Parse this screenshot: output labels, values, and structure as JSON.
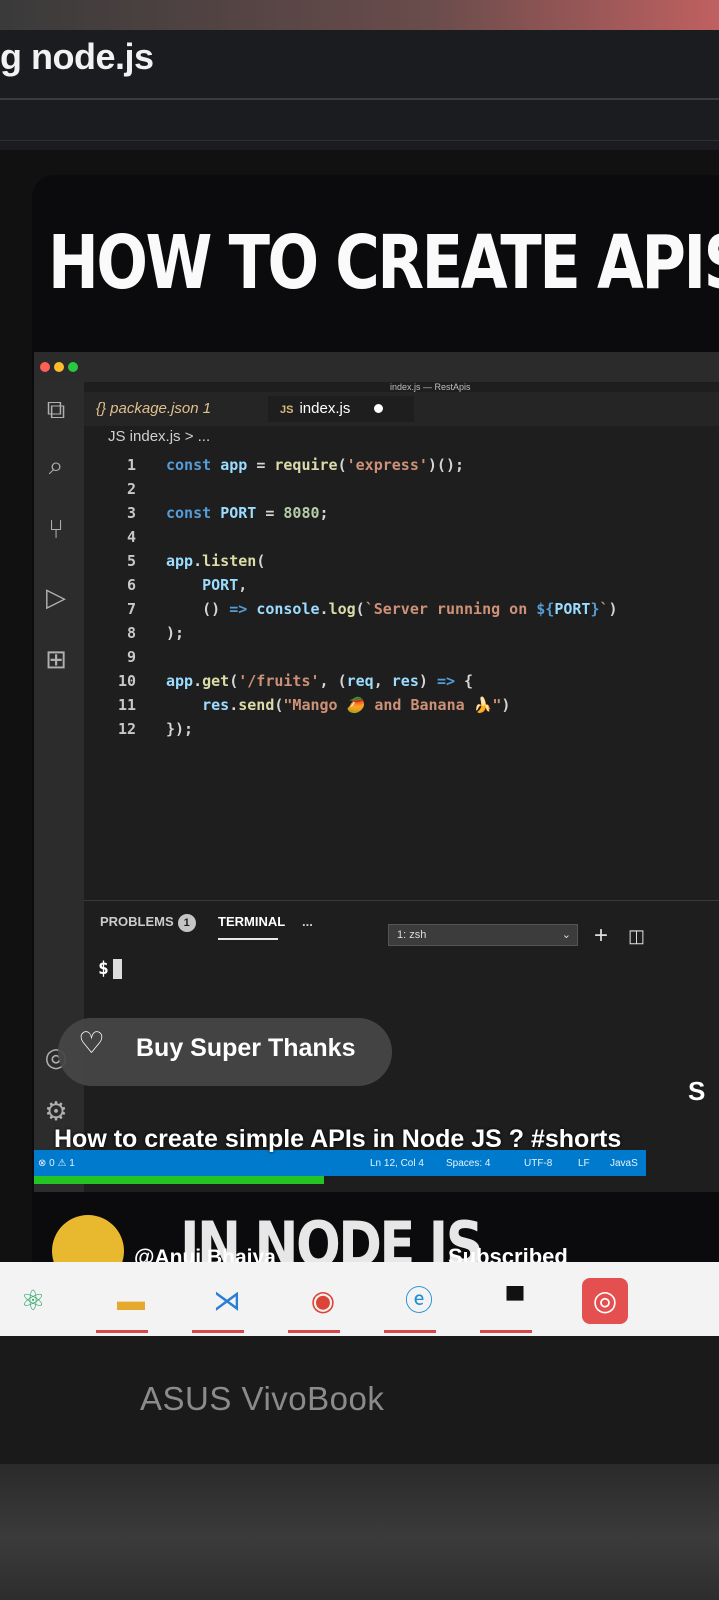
{
  "browser": {
    "page_title": "g node.js"
  },
  "video": {
    "title_overlay": "HOW TO CREATE APIS",
    "bottom_overlay": "IN NODE JS"
  },
  "vscode": {
    "window_title": "index.js — RestApis",
    "tabs": [
      {
        "label": "{} package.json 1",
        "active": false
      },
      {
        "label": "index.js",
        "active": true,
        "icon": "JS"
      }
    ],
    "breadcrumb": "JS index.js > ...",
    "code_lines": [
      {
        "num": "1"
      },
      {
        "num": "2"
      },
      {
        "num": "3"
      },
      {
        "num": "4"
      },
      {
        "num": "5"
      },
      {
        "num": "6"
      },
      {
        "num": "7"
      },
      {
        "num": "8"
      },
      {
        "num": "9"
      },
      {
        "num": "10"
      },
      {
        "num": "11"
      },
      {
        "num": "12"
      }
    ],
    "panel": {
      "problems_label": "PROBLEMS",
      "problems_count": "1",
      "terminal_label": "TERMINAL",
      "more_label": "...",
      "shell_select": "1: zsh",
      "prompt": "$"
    },
    "statusbar": {
      "problems": "⊗ 0 ⚠ 1",
      "position": "Ln 12, Col 4",
      "spaces": "Spaces: 4",
      "encoding": "UTF-8",
      "eol": "LF",
      "language": "JavaS"
    }
  },
  "youtube": {
    "super_thanks_label": "Buy Super Thanks",
    "video_title": "How to create simple APIs in Node JS ? #shorts",
    "channel_name": "@Anuj Bhaiya",
    "subscribe_state": "Subscribed",
    "side_letter": "S"
  },
  "taskbar": {
    "apps": [
      "atom-icon",
      "file-explorer-icon",
      "vscode-icon",
      "chrome-icon",
      "edge-icon",
      "terminal-icon",
      "app-icon"
    ]
  },
  "laptop": {
    "brand": "ASUS VivoBook"
  }
}
